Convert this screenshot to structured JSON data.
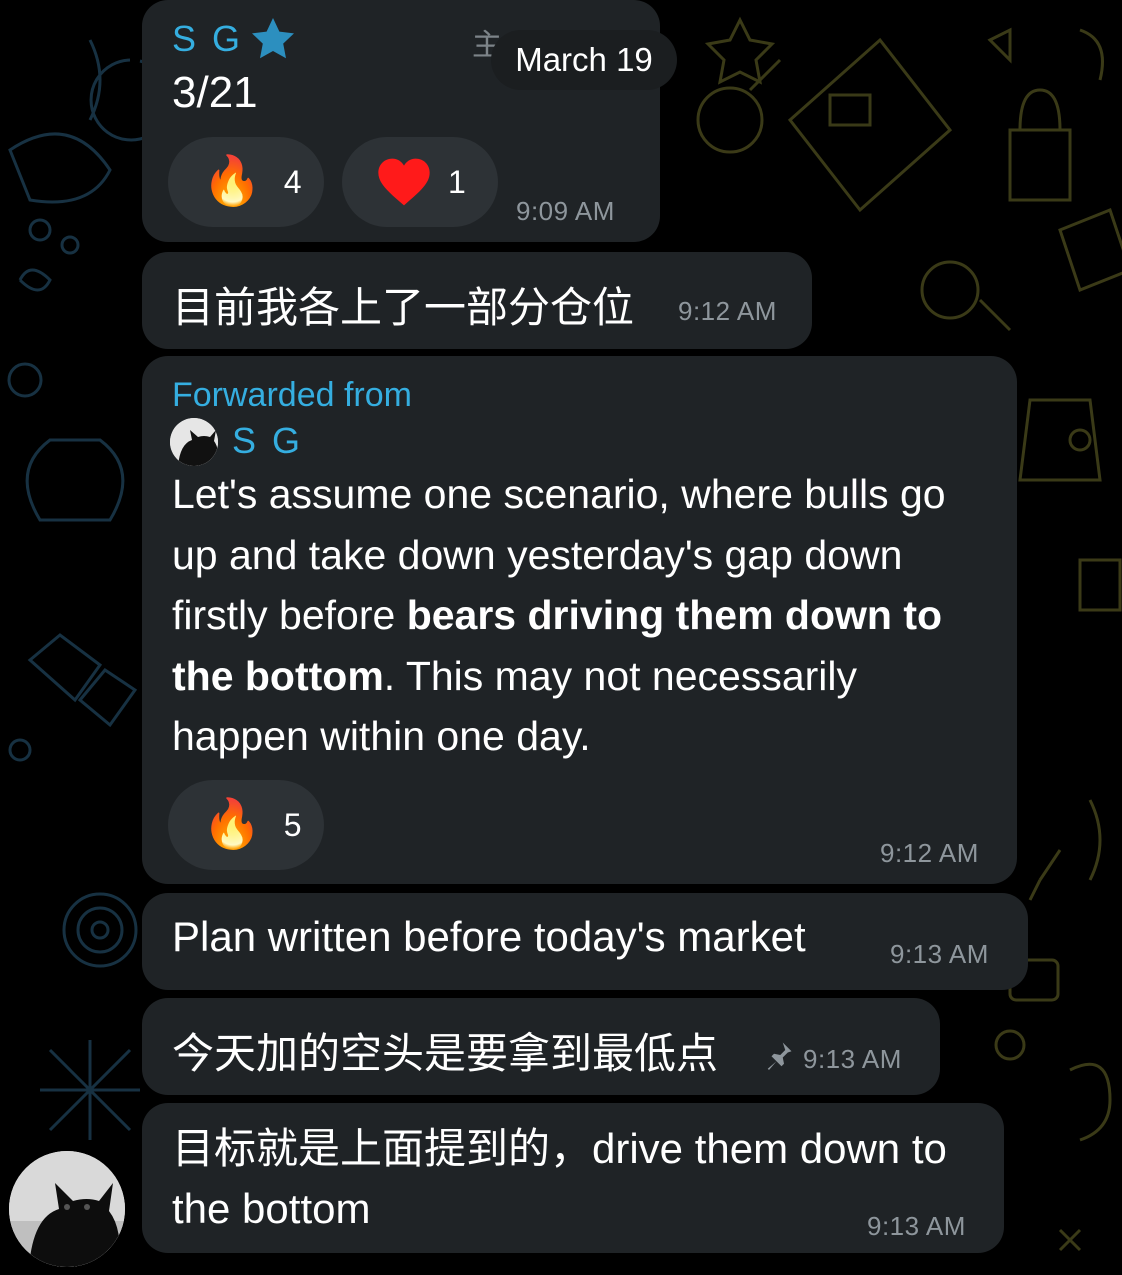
{
  "date_pill": "March 19",
  "messages": [
    {
      "sender": "S G",
      "text": "3/21",
      "partial_header": "主",
      "reactions": [
        {
          "emoji": "fire-icon",
          "count": "4"
        },
        {
          "emoji": "heart-icon",
          "count": "1"
        }
      ],
      "time": "9:09 AM"
    },
    {
      "text": "目前我各上了一部分仓位",
      "time": "9:12 AM"
    },
    {
      "forwarded_label": "Forwarded from",
      "forwarded_sender": "S G",
      "text_part1": "Let's assume one scenario, where bulls go up and take down yesterday's gap down firstly before ",
      "text_bold": "bears driving them down to the bottom",
      "text_part2": ". This may not necessarily happen within one day.",
      "reactions": [
        {
          "emoji": "fire-icon",
          "count": "5"
        }
      ],
      "time": "9:12 AM"
    },
    {
      "text": "Plan written before today's market",
      "time": "9:13 AM"
    },
    {
      "text": "今天加的空头是要拿到最低点",
      "time": "9:13 AM",
      "pinned": true
    },
    {
      "text": "目标就是上面提到的，drive them down to the bottom",
      "time": "9:13 AM"
    }
  ]
}
